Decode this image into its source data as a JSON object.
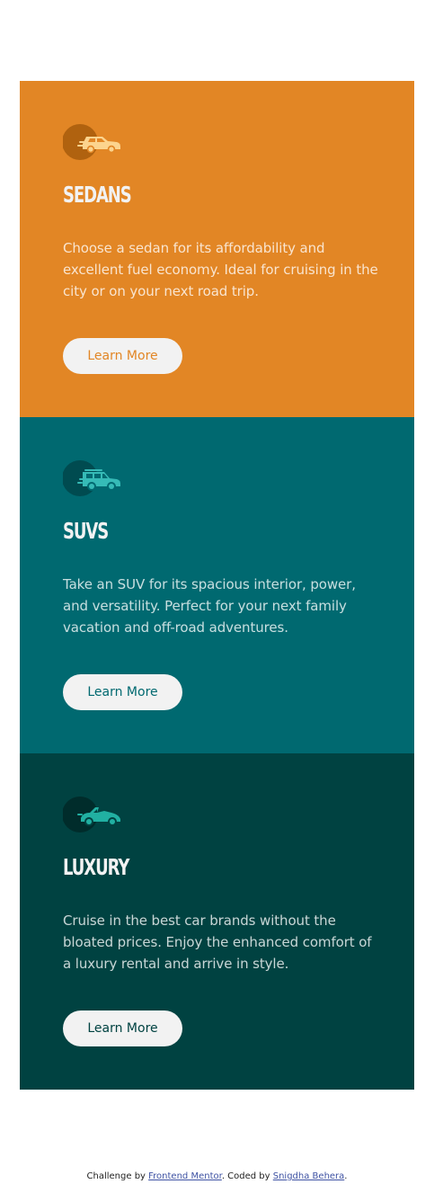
{
  "colors": {
    "sedans": "#e28625",
    "suvs": "#006970",
    "luxury": "#004241",
    "button_bg": "#f2f2f2",
    "heading": "#f2f2f2"
  },
  "cards": [
    {
      "title": "SEDANS",
      "icon": "sedan-car-icon",
      "description": "Choose a sedan for its affordability and excellent fuel economy. Ideal for cruising in the city or on your next road trip.",
      "button_label": "Learn More"
    },
    {
      "title": "SUVS",
      "icon": "suv-car-icon",
      "description": "Take an SUV for its spacious interior, power, and versatility. Perfect for your next family vacation and off-road adventures.",
      "button_label": "Learn More"
    },
    {
      "title": "LUXURY",
      "icon": "luxury-car-icon",
      "description": "Cruise in the best car brands without the bloated prices. Enjoy the enhanced comfort of a luxury rental and arrive in style.",
      "button_label": "Learn More"
    }
  ],
  "footer": {
    "prefix": "Challenge by ",
    "link1": "Frontend Mentor",
    "middle": ". Coded by ",
    "link2": "Snigdha Behera",
    "suffix": "."
  }
}
